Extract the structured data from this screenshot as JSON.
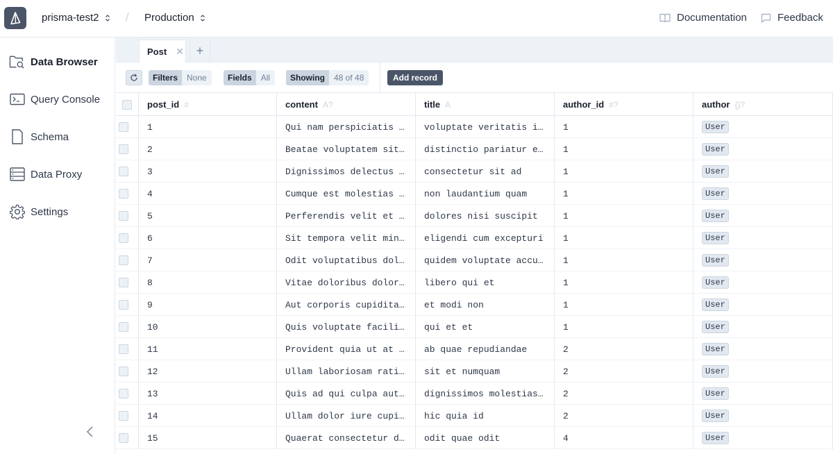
{
  "header": {
    "project": "prisma-test2",
    "separator": "/",
    "environment": "Production",
    "links": {
      "documentation": "Documentation",
      "feedback": "Feedback"
    }
  },
  "sidebar": {
    "items": [
      {
        "label": "Data Browser",
        "icon": "folder-search-icon",
        "active": true
      },
      {
        "label": "Query Console",
        "icon": "terminal-icon",
        "active": false
      },
      {
        "label": "Schema",
        "icon": "document-icon",
        "active": false
      },
      {
        "label": "Data Proxy",
        "icon": "server-icon",
        "active": false
      },
      {
        "label": "Settings",
        "icon": "gear-icon",
        "active": false
      }
    ]
  },
  "tabs": [
    {
      "label": "Post",
      "close": "✕"
    }
  ],
  "tab_add": "+",
  "toolbar": {
    "filters_label": "Filters",
    "filters_value": "None",
    "fields_label": "Fields",
    "fields_value": "All",
    "showing_label": "Showing",
    "showing_value": "48 of 48",
    "add_record": "Add record"
  },
  "table": {
    "columns": [
      {
        "name": "post_id",
        "type": "#"
      },
      {
        "name": "content",
        "type": "A?"
      },
      {
        "name": "title",
        "type": "A"
      },
      {
        "name": "author_id",
        "type": "#?"
      },
      {
        "name": "author",
        "type": "{}?"
      }
    ],
    "rows": [
      {
        "post_id": "1",
        "content": "Qui nam perspiciatis architecto",
        "title": "voluptate veritatis iusto",
        "author_id": "1",
        "author": "User"
      },
      {
        "post_id": "2",
        "content": "Beatae voluptatem sit amet",
        "title": "distinctio pariatur est",
        "author_id": "1",
        "author": "User"
      },
      {
        "post_id": "3",
        "content": "Dignissimos delectus quia",
        "title": "consectetur sit ad",
        "author_id": "1",
        "author": "User"
      },
      {
        "post_id": "4",
        "content": "Cumque est molestias quae",
        "title": "non laudantium quam",
        "author_id": "1",
        "author": "User"
      },
      {
        "post_id": "5",
        "content": "Perferendis velit et dolor",
        "title": "dolores nisi suscipit",
        "author_id": "1",
        "author": "User"
      },
      {
        "post_id": "6",
        "content": "Sit tempora velit minima",
        "title": "eligendi cum excepturi",
        "author_id": "1",
        "author": "User"
      },
      {
        "post_id": "7",
        "content": "Odit voluptatibus dolorem",
        "title": "quidem voluptate accusamus",
        "author_id": "1",
        "author": "User"
      },
      {
        "post_id": "8",
        "content": "Vitae doloribus dolores",
        "title": "libero qui et",
        "author_id": "1",
        "author": "User"
      },
      {
        "post_id": "9",
        "content": "Aut corporis cupiditate",
        "title": "et modi non",
        "author_id": "1",
        "author": "User"
      },
      {
        "post_id": "10",
        "content": "Quis voluptate facilis et",
        "title": "qui et et",
        "author_id": "1",
        "author": "User"
      },
      {
        "post_id": "11",
        "content": "Provident quia ut at ea",
        "title": "ab quae repudiandae",
        "author_id": "2",
        "author": "User"
      },
      {
        "post_id": "12",
        "content": "Ullam laboriosam ratione",
        "title": "sit et numquam",
        "author_id": "2",
        "author": "User"
      },
      {
        "post_id": "13",
        "content": "Quis ad qui culpa autem",
        "title": "dignissimos molestias ut",
        "author_id": "2",
        "author": "User"
      },
      {
        "post_id": "14",
        "content": "Ullam dolor iure cupiditate",
        "title": "hic quia id",
        "author_id": "2",
        "author": "User"
      },
      {
        "post_id": "15",
        "content": "Quaerat consectetur dolor",
        "title": "odit quae odit",
        "author_id": "4",
        "author": "User"
      }
    ]
  }
}
